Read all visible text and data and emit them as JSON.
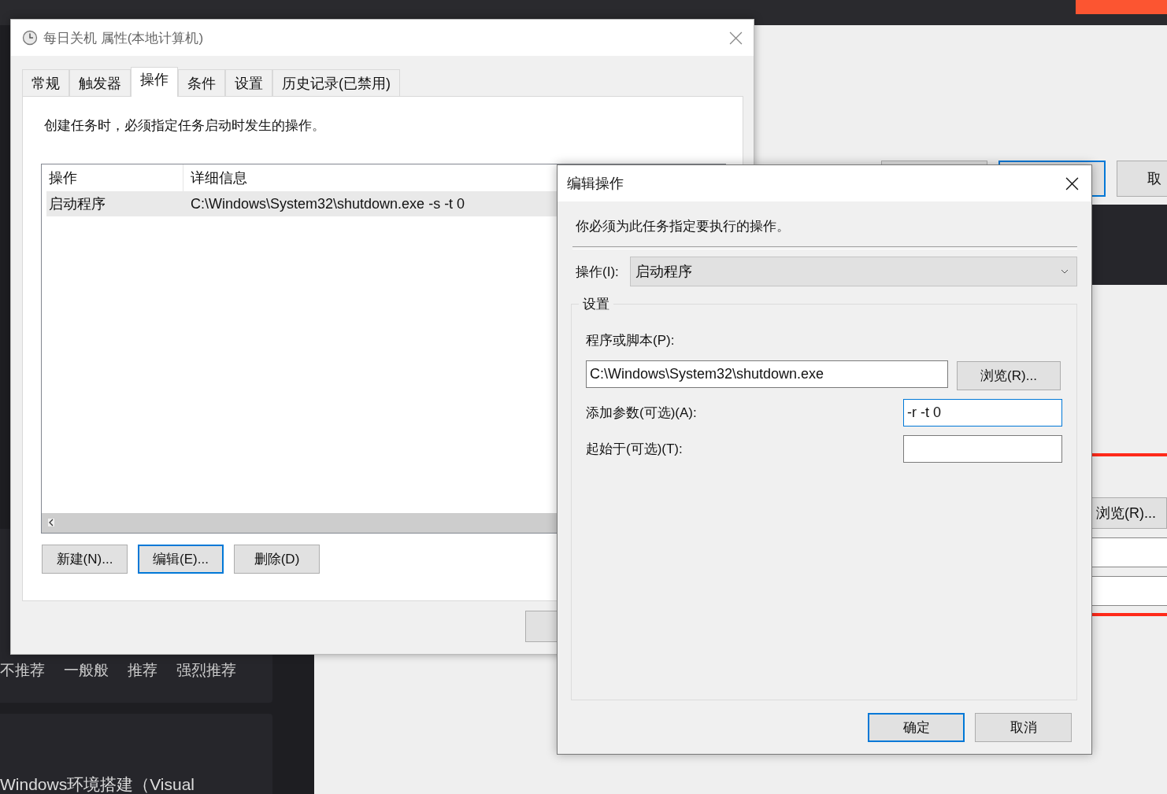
{
  "background": {
    "ratings": [
      "不推荐",
      "一般般",
      "推荐",
      "强烈推荐"
    ],
    "article_title": "Windows环境搭建（Visual",
    "cancel_fragment": "取",
    "browse_button": "浏览(R)..."
  },
  "properties_window": {
    "title": "每日关机 属性(本地计算机)",
    "tabs": [
      {
        "label": "常规",
        "selected": false
      },
      {
        "label": "触发器",
        "selected": false
      },
      {
        "label": "操作",
        "selected": true
      },
      {
        "label": "条件",
        "selected": false
      },
      {
        "label": "设置",
        "selected": false
      },
      {
        "label": "历史记录(已禁用)",
        "selected": false
      }
    ],
    "description": "创建任务时，必须指定任务启动时发生的操作。",
    "list": {
      "columns": [
        "操作",
        "详细信息"
      ],
      "rows": [
        {
          "cells": [
            "启动程序",
            "C:\\Windows\\System32\\shutdown.exe -s -t 0"
          ],
          "selected": true
        }
      ]
    },
    "buttons": [
      {
        "label": "新建(N)...",
        "focused": false
      },
      {
        "label": "编辑(E)...",
        "focused": true
      },
      {
        "label": "删除(D)",
        "focused": false
      }
    ]
  },
  "edit_dialog": {
    "title": "编辑操作",
    "description": "你必须为此任务指定要执行的操作。",
    "action_label": "操作(I):",
    "action_value": "启动程序",
    "group_label": "设置",
    "program_label": "程序或脚本(P):",
    "program_value": "C:\\Windows\\System32\\shutdown.exe",
    "browse_button": "浏览(R)...",
    "arguments_label": "添加参数(可选)(A):",
    "arguments_value": "-r -t 0",
    "arguments_focused": true,
    "start_in_label": "起始于(可选)(T):",
    "buttons": [
      {
        "label": "确定",
        "focused": true
      },
      {
        "label": "取消",
        "focused": false
      }
    ]
  }
}
